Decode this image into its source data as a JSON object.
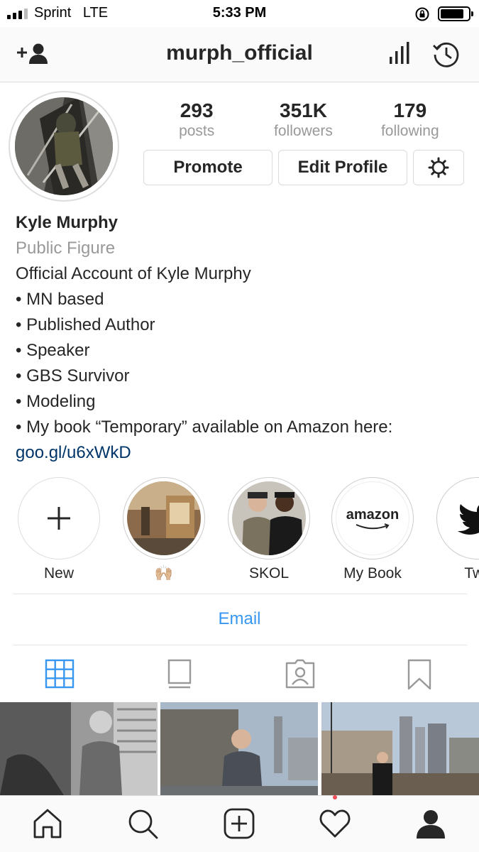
{
  "status_bar": {
    "carrier": "Sprint",
    "network": "LTE",
    "time": "5:33 PM"
  },
  "nav": {
    "username": "murph_official"
  },
  "stats": [
    {
      "value": "293",
      "label": "posts"
    },
    {
      "value": "351K",
      "label": "followers"
    },
    {
      "value": "179",
      "label": "following"
    }
  ],
  "buttons": {
    "promote": "Promote",
    "edit_profile": "Edit Profile"
  },
  "bio": {
    "name": "Kyle Murphy",
    "category": "Public Figure",
    "lines": [
      "Official Account of Kyle Murphy",
      "• MN based",
      "• Published Author",
      "• Speaker",
      "• GBS Survivor",
      "• Modeling",
      "• My book “Temporary” available on Amazon here:"
    ],
    "link": "goo.gl/u6xWkD"
  },
  "highlights": [
    {
      "label": "New"
    },
    {
      "label": "🙌🏼"
    },
    {
      "label": "SKOL"
    },
    {
      "label": "My Book",
      "logo_text": "amazon"
    },
    {
      "label": "Twit"
    }
  ],
  "contact": {
    "email": "Email"
  },
  "colors": {
    "link": "#003569",
    "accent": "#3897f0",
    "notification": "#ed4956"
  }
}
